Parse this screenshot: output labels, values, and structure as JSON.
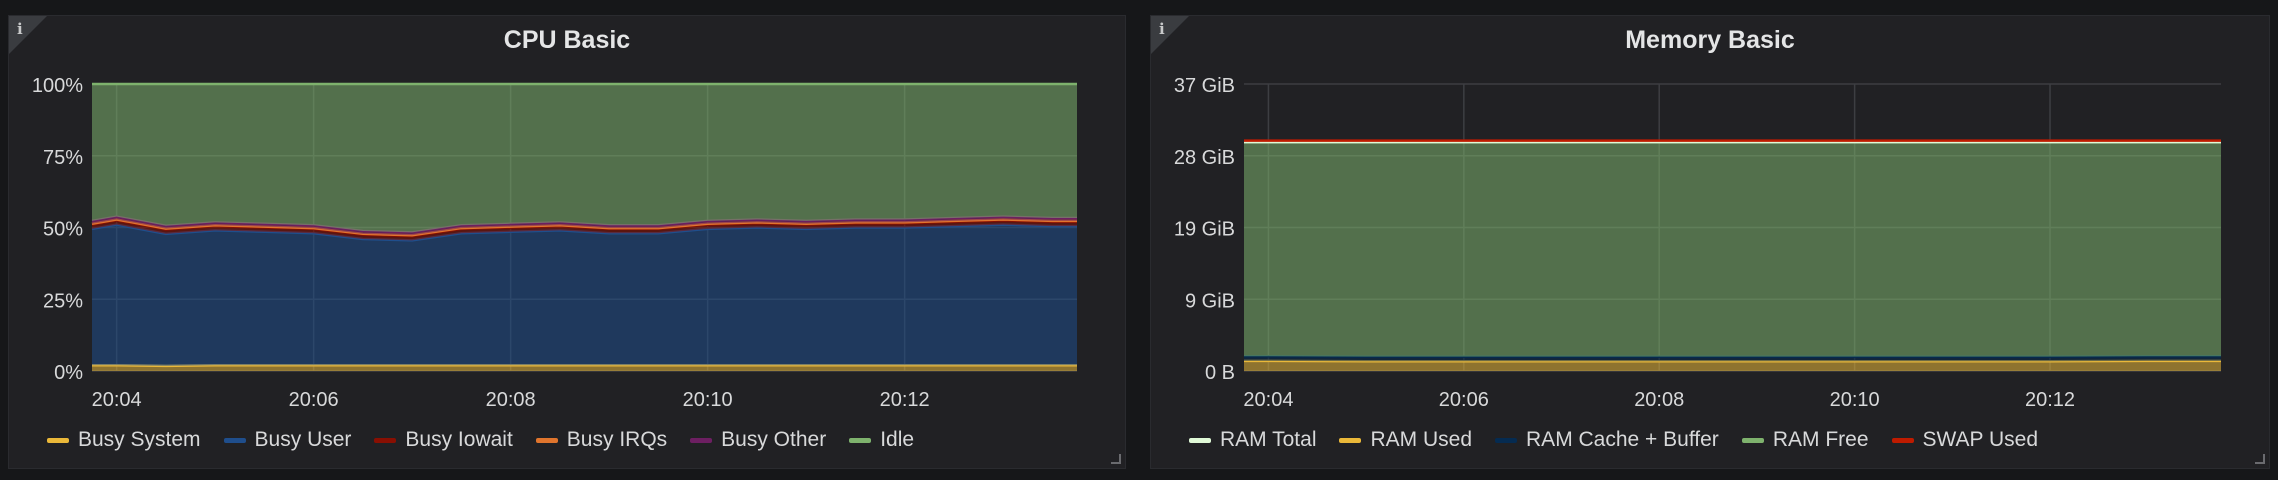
{
  "panels": {
    "cpu": {
      "title": "CPU Basic",
      "info_icon": "i",
      "legend": [
        {
          "label": "Busy System",
          "color": "#eab839"
        },
        {
          "label": "Busy User",
          "color": "#1f4e8c"
        },
        {
          "label": "Busy Iowait",
          "color": "#890f02"
        },
        {
          "label": "Busy IRQs",
          "color": "#e0752d"
        },
        {
          "label": "Busy Other",
          "color": "#6d1f62"
        },
        {
          "label": "Idle",
          "color": "#7eb26d"
        }
      ]
    },
    "mem": {
      "title": "Memory Basic",
      "info_icon": "i",
      "legend": [
        {
          "label": "RAM Total",
          "color": "#e0f9d7"
        },
        {
          "label": "RAM Used",
          "color": "#eab839"
        },
        {
          "label": "RAM Cache + Buffer",
          "color": "#052b51"
        },
        {
          "label": "RAM Free",
          "color": "#7eb26d"
        },
        {
          "label": "SWAP Used",
          "color": "#bf1b00"
        }
      ]
    }
  },
  "chart_data": [
    {
      "type": "area",
      "title": "CPU Basic",
      "xlabel": "",
      "ylabel": "",
      "x": [
        "20:03:45",
        "20:04",
        "20:04:30",
        "20:05",
        "20:05:30",
        "20:06",
        "20:06:30",
        "20:07",
        "20:07:30",
        "20:08",
        "20:08:30",
        "20:09",
        "20:09:30",
        "20:10",
        "20:10:30",
        "20:11",
        "20:11:30",
        "20:12",
        "20:12:30",
        "20:13",
        "20:13:30",
        "20:13:45"
      ],
      "x_tick_labels": [
        "20:04",
        "20:06",
        "20:08",
        "20:10",
        "20:12"
      ],
      "y_tick_labels": [
        "0%",
        "25%",
        "50%",
        "75%",
        "100%"
      ],
      "ylim": [
        0,
        100
      ],
      "stacked": true,
      "series": [
        {
          "name": "Busy System",
          "color": "#eab839",
          "values": [
            2,
            2,
            1.8,
            2,
            2,
            2,
            2,
            2,
            2,
            2,
            2,
            2,
            2,
            2,
            2,
            2,
            2,
            2,
            2,
            2,
            2,
            2
          ]
        },
        {
          "name": "Busy User",
          "color": "#1f4e8c",
          "values": [
            47.5,
            49,
            46,
            47,
            46.5,
            46,
            44,
            43.5,
            46,
            46.5,
            47,
            46,
            46,
            47.5,
            48,
            47.5,
            48,
            48,
            48.5,
            49,
            48.5,
            48.5
          ]
        },
        {
          "name": "Busy Iowait",
          "color": "#890f02",
          "values": [
            1.5,
            1.5,
            1.5,
            1.5,
            1.5,
            1.5,
            1.5,
            1.5,
            1.5,
            1.5,
            1.5,
            1.5,
            1.5,
            1.5,
            1.5,
            1.5,
            1.5,
            1.5,
            1.5,
            1.5,
            1.5,
            1.5
          ]
        },
        {
          "name": "Busy IRQs",
          "color": "#e0752d",
          "values": [
            0.3,
            0.3,
            0.3,
            0.3,
            0.3,
            0.3,
            0.3,
            0.3,
            0.3,
            0.3,
            0.3,
            0.3,
            0.3,
            0.3,
            0.3,
            0.3,
            0.3,
            0.3,
            0.3,
            0.3,
            0.3,
            0.3
          ]
        },
        {
          "name": "Busy Other",
          "color": "#6d1f62",
          "values": [
            1,
            1,
            1,
            1,
            1,
            1,
            1,
            1,
            1,
            1,
            1,
            1,
            1,
            1,
            1,
            1,
            1,
            1,
            1,
            1,
            1,
            1
          ]
        },
        {
          "name": "Idle",
          "color": "#7eb26d",
          "values": [
            47.7,
            46.2,
            49.4,
            48.2,
            48.7,
            49.2,
            51.2,
            51.7,
            49.2,
            48.7,
            48.2,
            49.2,
            49.2,
            47.7,
            47.2,
            47.7,
            47.2,
            47.2,
            46.7,
            46.2,
            46.7,
            46.7
          ]
        }
      ],
      "grid": true,
      "legend_position": "bottom-left"
    },
    {
      "type": "area",
      "title": "Memory Basic",
      "xlabel": "",
      "ylabel": "",
      "x": [
        "20:03:45",
        "20:04",
        "20:05",
        "20:06",
        "20:07",
        "20:08",
        "20:09",
        "20:10",
        "20:11",
        "20:12",
        "20:13",
        "20:13:45"
      ],
      "x_tick_labels": [
        "20:04",
        "20:06",
        "20:08",
        "20:10",
        "20:12"
      ],
      "y_tick_labels": [
        "0 B",
        "9 GiB",
        "19 GiB",
        "28 GiB",
        "37 GiB"
      ],
      "ylim": [
        0,
        37
      ],
      "stacked": true,
      "series": [
        {
          "name": "RAM Used",
          "color": "#eab839",
          "values": [
            1.3,
            1.3,
            1.25,
            1.25,
            1.25,
            1.25,
            1.25,
            1.25,
            1.25,
            1.25,
            1.3,
            1.3
          ]
        },
        {
          "name": "RAM Cache + Buffer",
          "color": "#052b51",
          "values": [
            0.6,
            0.6,
            0.6,
            0.6,
            0.6,
            0.6,
            0.6,
            0.6,
            0.6,
            0.6,
            0.6,
            0.6
          ]
        },
        {
          "name": "RAM Free",
          "color": "#7eb26d",
          "values": [
            27.6,
            27.6,
            27.65,
            27.65,
            27.65,
            27.65,
            27.65,
            27.65,
            27.65,
            27.65,
            27.6,
            27.6
          ]
        }
      ],
      "lines": [
        {
          "name": "RAM Total",
          "color": "#e0f9d7",
          "values": [
            29.5,
            29.5,
            29.5,
            29.5,
            29.5,
            29.5,
            29.5,
            29.5,
            29.5,
            29.5,
            29.5,
            29.5
          ]
        },
        {
          "name": "SWAP Used",
          "color": "#bf1b00",
          "values": [
            29.7,
            29.7,
            29.7,
            29.7,
            29.7,
            29.7,
            29.7,
            29.7,
            29.7,
            29.7,
            29.7,
            29.7
          ]
        }
      ],
      "grid": true,
      "legend_position": "bottom-left"
    }
  ]
}
